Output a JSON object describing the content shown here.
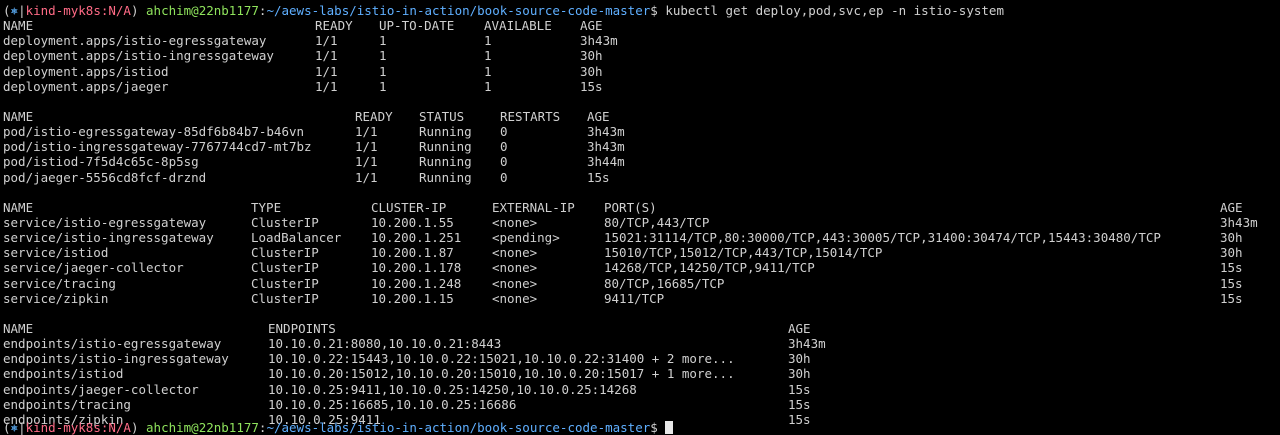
{
  "prompt": {
    "open_paren": "(",
    "k8s_symbol": "⎈",
    "sep": "|",
    "context": "kind-myk8s:N/A",
    "close_paren": ")",
    "space": " ",
    "user_host": "ahchim@22nb1177",
    "colon": ":",
    "path": "~/aews-labs/istio-in-action/book-source-code-master",
    "dollar": "$ ",
    "command": "kubectl get deploy,pod,svc,ep -n istio-system"
  },
  "deployments": {
    "headers": [
      "NAME",
      "READY",
      "UP-TO-DATE",
      "AVAILABLE",
      "AGE"
    ],
    "rows": [
      [
        "deployment.apps/istio-egressgateway",
        "1/1",
        "1",
        "1",
        "3h43m"
      ],
      [
        "deployment.apps/istio-ingressgateway",
        "1/1",
        "1",
        "1",
        "30h"
      ],
      [
        "deployment.apps/istiod",
        "1/1",
        "1",
        "1",
        "30h"
      ],
      [
        "deployment.apps/jaeger",
        "1/1",
        "1",
        "1",
        "15s"
      ]
    ]
  },
  "pods": {
    "headers": [
      "NAME",
      "READY",
      "STATUS",
      "RESTARTS",
      "AGE"
    ],
    "rows": [
      [
        "pod/istio-egressgateway-85df6b84b7-b46vn",
        "1/1",
        "Running",
        "0",
        "3h43m"
      ],
      [
        "pod/istio-ingressgateway-7767744cd7-mt7bz",
        "1/1",
        "Running",
        "0",
        "3h43m"
      ],
      [
        "pod/istiod-7f5d4c65c-8p5sg",
        "1/1",
        "Running",
        "0",
        "3h44m"
      ],
      [
        "pod/jaeger-5556cd8fcf-drznd",
        "1/1",
        "Running",
        "0",
        "15s"
      ]
    ]
  },
  "services": {
    "headers": [
      "NAME",
      "TYPE",
      "CLUSTER-IP",
      "EXTERNAL-IP",
      "PORT(S)",
      "AGE"
    ],
    "rows": [
      [
        "service/istio-egressgateway",
        "ClusterIP",
        "10.200.1.55",
        "<none>",
        "80/TCP,443/TCP",
        "3h43m"
      ],
      [
        "service/istio-ingressgateway",
        "LoadBalancer",
        "10.200.1.251",
        "<pending>",
        "15021:31114/TCP,80:30000/TCP,443:30005/TCP,31400:30474/TCP,15443:30480/TCP",
        "30h"
      ],
      [
        "service/istiod",
        "ClusterIP",
        "10.200.1.87",
        "<none>",
        "15010/TCP,15012/TCP,443/TCP,15014/TCP",
        "30h"
      ],
      [
        "service/jaeger-collector",
        "ClusterIP",
        "10.200.1.178",
        "<none>",
        "14268/TCP,14250/TCP,9411/TCP",
        "15s"
      ],
      [
        "service/tracing",
        "ClusterIP",
        "10.200.1.248",
        "<none>",
        "80/TCP,16685/TCP",
        "15s"
      ],
      [
        "service/zipkin",
        "ClusterIP",
        "10.200.1.15",
        "<none>",
        "9411/TCP",
        "15s"
      ]
    ]
  },
  "endpoints": {
    "headers": [
      "NAME",
      "ENDPOINTS",
      "AGE"
    ],
    "rows": [
      [
        "endpoints/istio-egressgateway",
        "10.10.0.21:8080,10.10.0.21:8443",
        "3h43m"
      ],
      [
        "endpoints/istio-ingressgateway",
        "10.10.0.22:15443,10.10.0.22:15021,10.10.0.22:31400 + 2 more...",
        "30h"
      ],
      [
        "endpoints/istiod",
        "10.10.0.20:15012,10.10.0.20:15010,10.10.0.20:15017 + 1 more...",
        "30h"
      ],
      [
        "endpoints/jaeger-collector",
        "10.10.0.25:9411,10.10.0.25:14250,10.10.0.25:14268",
        "15s"
      ],
      [
        "endpoints/tracing",
        "10.10.0.25:16685,10.10.0.25:16686",
        "15s"
      ],
      [
        "endpoints/zipkin",
        "10.10.0.25:9411",
        "15s"
      ]
    ]
  },
  "next_prompt": {
    "open_paren": "(",
    "k8s_symbol": "⎈",
    "sep": "|",
    "context": "kind-myk8s:N/A",
    "close_paren": ")",
    "space": " ",
    "user_host": "ahchim@22nb1177",
    "colon": ":",
    "path": "~/aews-labs/istio-in-action/book-source-code-master",
    "dollar": "$ "
  },
  "colors": {
    "background": "#000000",
    "text": "#d0d0d0",
    "context": "#ff6b86",
    "user_host": "#8fe35c",
    "path": "#5fafff"
  }
}
